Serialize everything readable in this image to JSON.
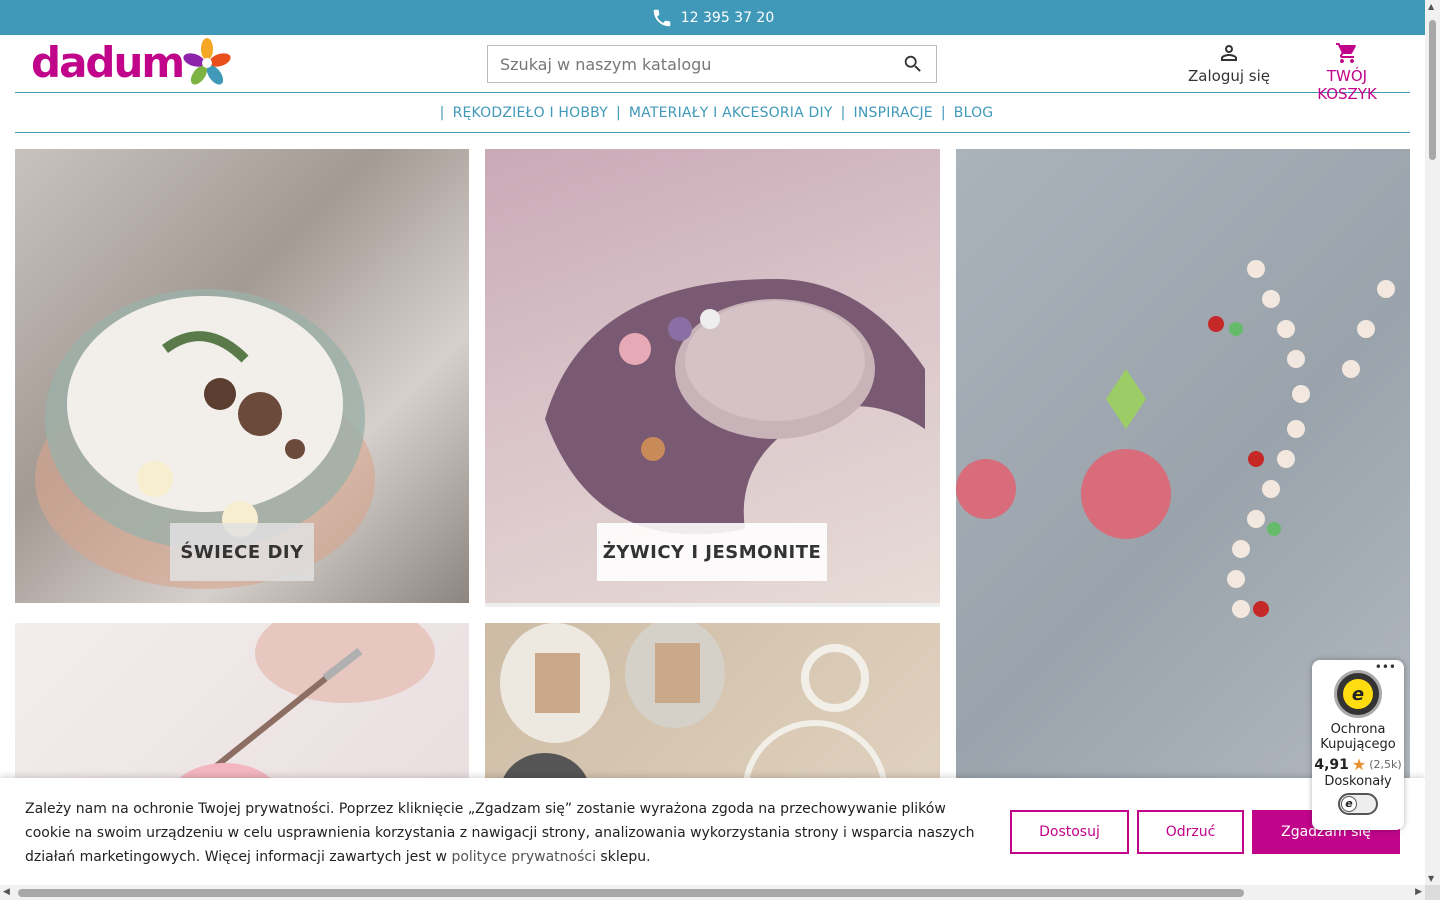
{
  "topbar": {
    "phone_icon": "phone-icon",
    "phone": "12 395 37 20"
  },
  "header": {
    "logo_text": "dadum",
    "search": {
      "placeholder": "Szukaj w naszym katalogu",
      "value": "",
      "icon": "search-icon"
    },
    "account": {
      "icon": "user-icon",
      "label": "Zaloguj się"
    },
    "cart": {
      "icon": "cart-icon",
      "label": "TWÓJ KOSZYK"
    }
  },
  "nav": {
    "separator": "|",
    "items": [
      {
        "label": "RĘKODZIEŁO I HOBBY"
      },
      {
        "label": "MATERIAŁY I AKCESORIA DIY"
      },
      {
        "label": "INSPIRACJE"
      },
      {
        "label": "BLOG"
      }
    ]
  },
  "tiles": [
    {
      "caption": "ŚWIECE DIY"
    },
    {
      "caption": "ŻYWICY I JESMONITE"
    }
  ],
  "cookie": {
    "text_before": "Zależy nam na ochronie Twojej prywatności. Poprzez kliknięcie „Zgadzam się” zostanie wyrażona zgoda na przechowywanie plików cookie na swoim urządzeniu w celu usprawnienia korzystania z nawigacji strony, analizowania wykorzystania strony i wsparcia naszych działań marketingowych. Więcej informacji zawartych jest w ",
    "link": "polityce prywatności",
    "text_after": " sklepu.",
    "buttons": {
      "customize": "Dostosuj",
      "reject": "Odrzuć",
      "accept": "Zgadzam się"
    }
  },
  "trust_badge": {
    "menu": "•••",
    "seal_letter": "e",
    "title": "Ochrona Kupującego",
    "score": "4,91",
    "star": "★",
    "count": "(2,5k)",
    "grade": "Doskonały"
  },
  "colors": {
    "brand_blue": "#4099b8",
    "brand_magenta": "#c0058a"
  }
}
